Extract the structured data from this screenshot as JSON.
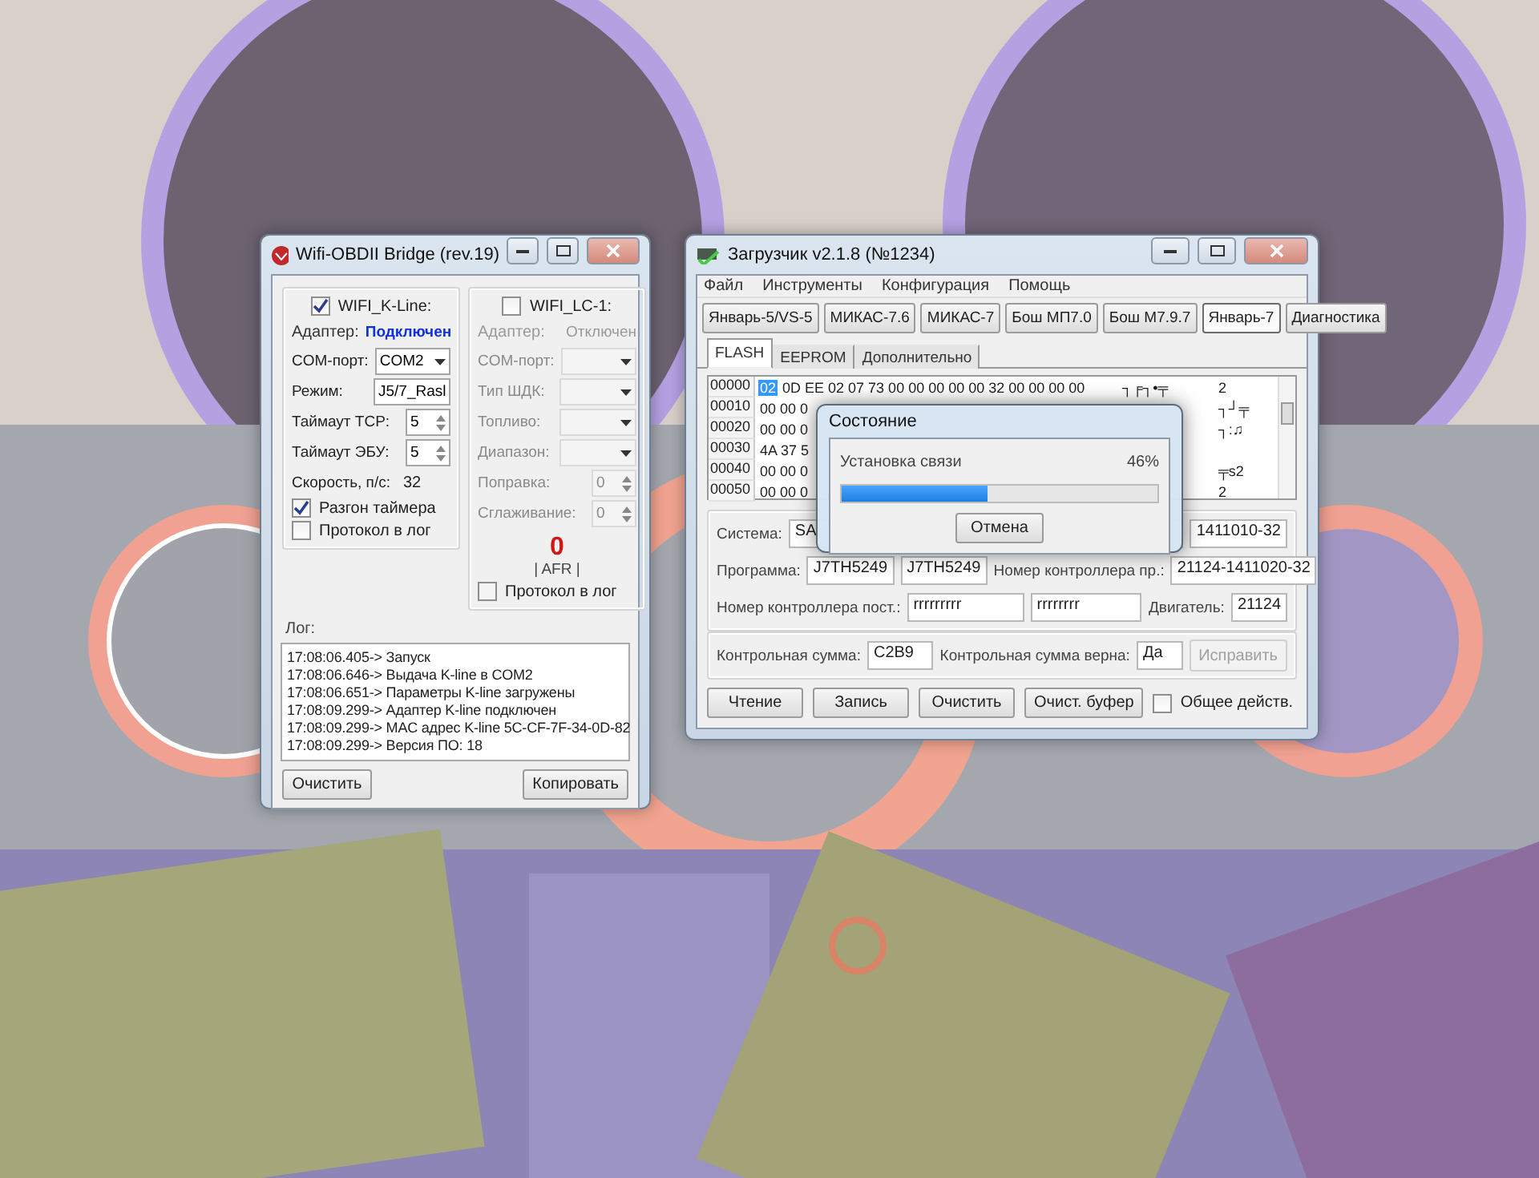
{
  "bridge_window": {
    "title": "Wifi-OBDII Bridge (rev.19)",
    "groups": [
      {
        "label": "WIFI_K-Line:",
        "checked": true,
        "adapter_label": "Адаптер:",
        "adapter_status": "Подключен",
        "connected": true,
        "fields": [
          {
            "kind": "select",
            "label": "COM-порт:",
            "value": "COM2",
            "disabled": false
          },
          {
            "kind": "select",
            "label": "Режим:",
            "value": "J5/7_Rasl",
            "disabled": false
          },
          {
            "kind": "spin",
            "label": "Таймаут TCP:",
            "value": "5",
            "disabled": false
          },
          {
            "kind": "spin",
            "label": "Таймаут ЭБУ:",
            "value": "5",
            "disabled": false
          },
          {
            "kind": "text",
            "label": "Скорость, п/с:",
            "value": "32",
            "disabled": false
          }
        ],
        "checks": [
          {
            "label": "Разгон таймера",
            "checked": true
          },
          {
            "label": "Протокол в лог",
            "checked": false
          }
        ]
      },
      {
        "label": "WIFI_LC-1:",
        "checked": false,
        "adapter_label": "Адаптер:",
        "adapter_status": "Отключен",
        "connected": false,
        "fields": [
          {
            "kind": "select",
            "label": "COM-порт:",
            "disabled": true
          },
          {
            "kind": "select",
            "label": "Тип ШДК:",
            "disabled": true
          },
          {
            "kind": "select",
            "label": "Топливо:",
            "disabled": true
          },
          {
            "kind": "select",
            "label": "Диапазон:",
            "disabled": true
          },
          {
            "kind": "spin",
            "label": "Поправка:",
            "value": "0",
            "disabled": true
          },
          {
            "kind": "spin",
            "label": "Сглаживание:",
            "value": "0",
            "disabled": true
          }
        ],
        "afr_value": "0",
        "afr_label": "| AFR |",
        "checks": [
          {
            "label": "Протокол в лог",
            "checked": false
          }
        ]
      }
    ],
    "log_label": "Лог:",
    "log_lines": [
      "17:08:06.405-> Запуск",
      "17:08:06.646-> Выдача K-line в COM2",
      "17:08:06.651-> Параметры K-line загружены",
      "17:08:09.299-> Адаптер K-line подключен",
      "17:08:09.299-> MAC адрес K-line 5C-CF-7F-34-0D-82",
      "17:08:09.299-> Версия ПО: 18"
    ],
    "buttons": [
      "Очистить",
      "Копировать"
    ]
  },
  "loader_window": {
    "title": "Загрузчик v2.1.8 (№1234)",
    "menu": [
      "Файл",
      "Инструменты",
      "Конфигурация",
      "Помощь"
    ],
    "ecu_buttons": [
      {
        "label": "Январь-5/VS-5",
        "selected": false
      },
      {
        "label": "МИКАС-7.6",
        "selected": false
      },
      {
        "label": "МИКАС-7",
        "selected": false
      },
      {
        "label": "Бош МП7.0",
        "selected": false
      },
      {
        "label": "Бош М7.9.7",
        "selected": false
      },
      {
        "label": "Январь-7",
        "selected": true
      },
      {
        "label": "Диагностика",
        "selected": false
      }
    ],
    "tabs": [
      {
        "label": "FLASH",
        "selected": true
      },
      {
        "label": "EEPROM",
        "selected": false
      },
      {
        "label": "Дополнительно",
        "selected": false
      }
    ],
    "hex_rows": [
      {
        "address": "00000",
        "bytes": [
          {
            "text": "02",
            "selected": true
          },
          {
            "text": "0D EE 02 07 73 00 00 00 00 00 32 00 00 00 00",
            "selected": false
          }
        ],
        "ascii": "┐╒┐•╤",
        "tail": "2"
      },
      {
        "address": "00010",
        "bytes": [
          {
            "text": "00 00 0",
            "selected": false
          }
        ],
        "tail": "┐┘╤"
      },
      {
        "address": "00020",
        "bytes": [
          {
            "text": "00 00 0",
            "selected": false
          }
        ],
        "tail": "┐:♫"
      },
      {
        "address": "00030",
        "bytes": [
          {
            "text": "4A 37 5",
            "selected": false
          }
        ]
      },
      {
        "address": "00040",
        "bytes": [
          {
            "text": "00 00 0",
            "selected": false
          }
        ],
        "tail": "╤s2"
      },
      {
        "address": "00050",
        "bytes": [
          {
            "text": "00 00 0",
            "selected": false
          }
        ],
        "tail": "2"
      }
    ],
    "info_rows": [
      [
        {
          "kind": "label",
          "text": "Система:"
        },
        {
          "kind": "field",
          "text": "SA"
        },
        {
          "kind": "field",
          "text": "1411010-32"
        }
      ],
      [
        {
          "kind": "label",
          "text": "Программа:"
        },
        {
          "kind": "field",
          "text": "J7TH5249"
        },
        {
          "kind": "field",
          "text": "J7TH5249"
        },
        {
          "kind": "label",
          "text": "Номер контроллера пр.:"
        },
        {
          "kind": "field",
          "text": "21124-1411020-32"
        }
      ],
      [
        {
          "kind": "label",
          "text": "Номер контроллера пост.:"
        },
        {
          "kind": "field",
          "text": "rrrrrrrrr"
        },
        {
          "kind": "field",
          "text": "rrrrrrrr"
        },
        {
          "kind": "label",
          "text": "Двигатель:"
        },
        {
          "kind": "field",
          "text": "21124"
        }
      ]
    ],
    "checksum_row": [
      {
        "kind": "label",
        "text": "Контрольная сумма:"
      },
      {
        "kind": "field",
        "text": "C2B9"
      },
      {
        "kind": "label",
        "text": "Контрольная сумма верна:"
      },
      {
        "kind": "field",
        "text": "Да"
      },
      {
        "kind": "button",
        "text": "Исправить",
        "disabled": true
      }
    ],
    "actions": [
      "Чтение",
      "Запись",
      "Очистить",
      "Очист. буфер"
    ],
    "common_action": {
      "label": "Общее действ.",
      "checked": false
    }
  },
  "status_dialog": {
    "title": "Состояние",
    "label": "Установка связи",
    "percent": "46%",
    "level": 0.46,
    "button": "Отмена"
  }
}
